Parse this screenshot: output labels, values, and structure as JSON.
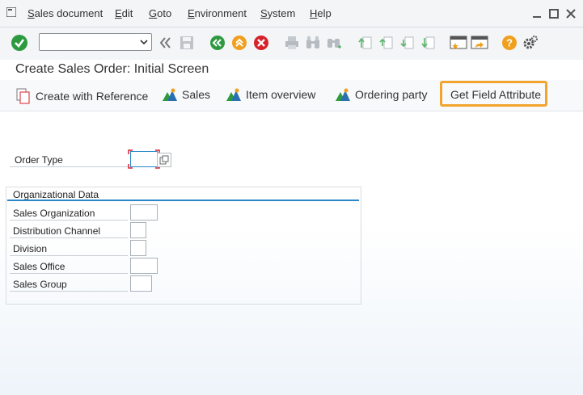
{
  "menubar": {
    "items": [
      "Sales document",
      "Edit",
      "Goto",
      "Environment",
      "System",
      "Help"
    ]
  },
  "toolbar": {
    "command_field_value": "",
    "buttons": [
      "enter-icon",
      "back-double-icon",
      "save-icon",
      "back-icon",
      "exit-icon",
      "cancel-icon",
      "print-icon",
      "find-icon",
      "find-next-icon",
      "first-page-icon",
      "previous-page-icon",
      "next-page-icon",
      "last-page-icon",
      "create-session-icon",
      "shortcut-icon",
      "help-icon",
      "settings-icon"
    ]
  },
  "page": {
    "title": "Create Sales Order: Initial Screen"
  },
  "appbar": {
    "create_with_reference": "Create with Reference",
    "sales": "Sales",
    "item_overview": "Item overview",
    "ordering_party": "Ordering party",
    "get_field_attribute": "Get Field Attribute"
  },
  "form": {
    "order_type_label": "Order Type",
    "order_type_value": "",
    "org_group_title": "Organizational Data",
    "sales_org_label": "Sales Organization",
    "distribution_channel_label": "Distribution Channel",
    "division_label": "Division",
    "sales_office_label": "Sales Office",
    "sales_group_label": "Sales Group"
  },
  "colors": {
    "highlight": "#f2a42c",
    "accent_blue": "#2a88c9",
    "green": "#2e9a3f",
    "orange": "#f0a01e",
    "red": "#d8222b"
  }
}
